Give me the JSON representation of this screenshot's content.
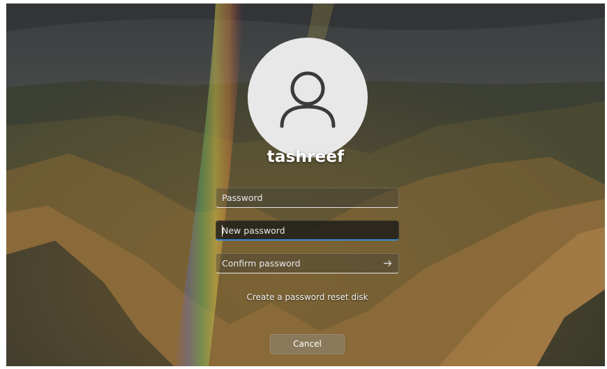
{
  "user": {
    "avatar_icon": "user-silhouette-icon",
    "name": "tashreef"
  },
  "form": {
    "password_placeholder": "Password",
    "new_password_placeholder": "New password",
    "confirm_password_placeholder": "Confirm password",
    "submit_icon": "arrow-right-icon"
  },
  "links": {
    "reset_disk": "Create a password reset disk"
  },
  "buttons": {
    "cancel": "Cancel"
  },
  "colors": {
    "focus_accent": "#3a8bd9",
    "avatar_bg": "#e8e8e8"
  }
}
